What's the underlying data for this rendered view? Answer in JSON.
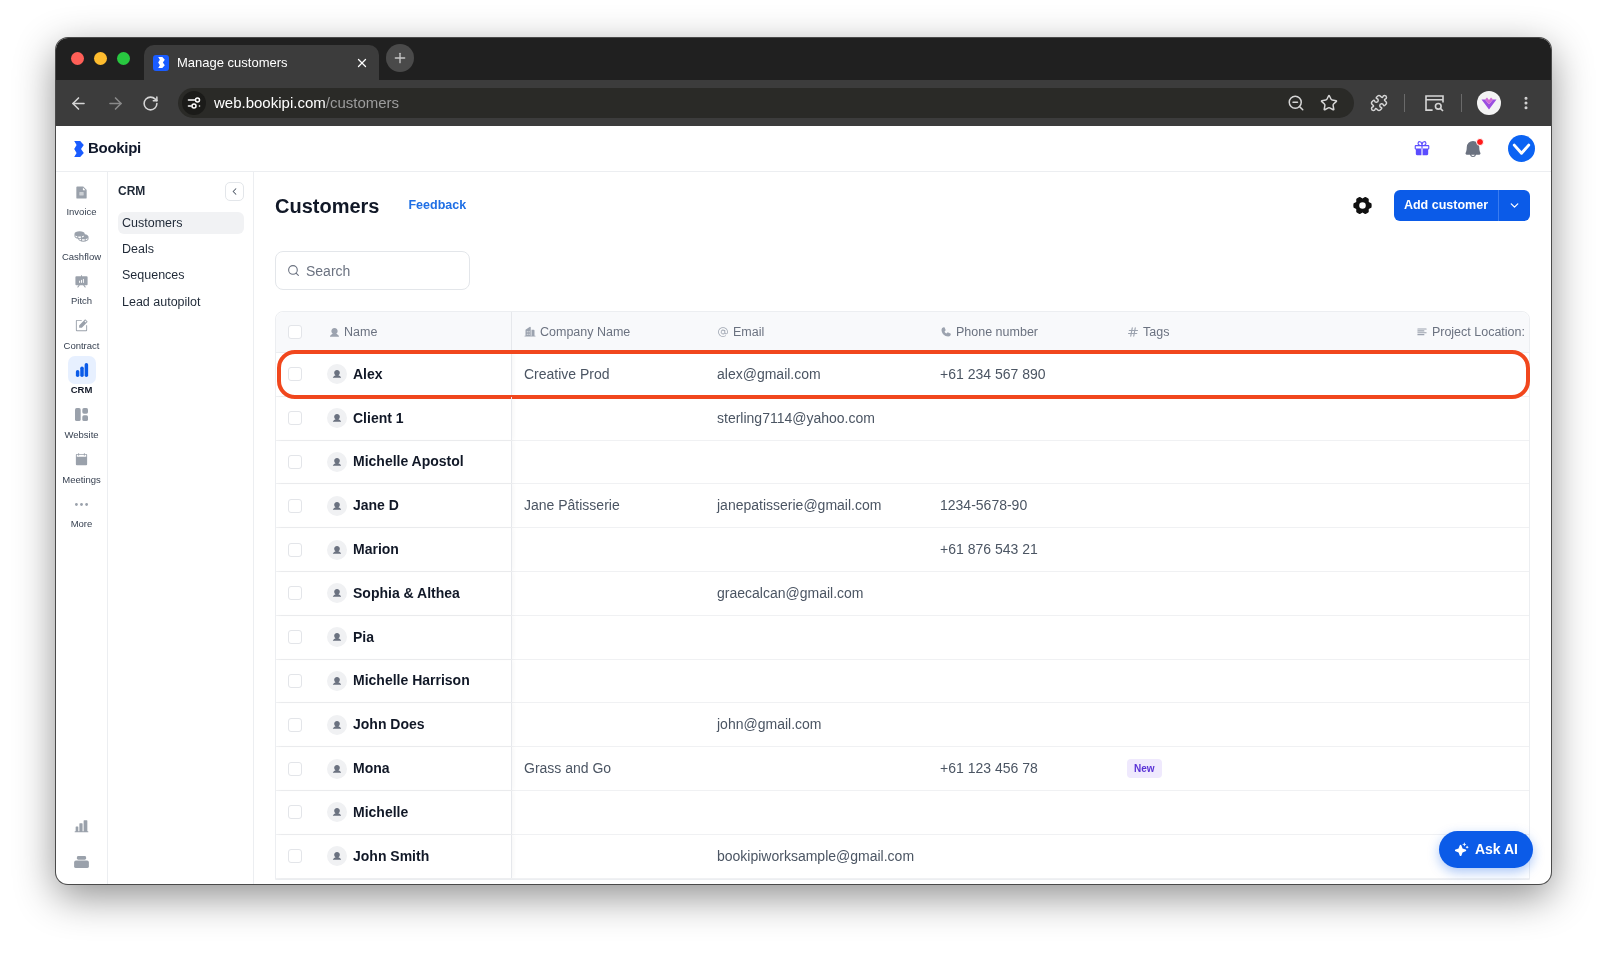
{
  "browser": {
    "tabs": [
      {
        "title": "Manage customers",
        "selected": true
      }
    ],
    "url": {
      "host": "web.bookipi.com",
      "path": "/customers"
    }
  },
  "header": {
    "logo": "Bookipi",
    "has_notifications": true
  },
  "rail": {
    "items": [
      {
        "label": "Invoice",
        "selected": false
      },
      {
        "label": "Cashflow",
        "selected": false
      },
      {
        "label": "Pitch",
        "selected": false
      },
      {
        "label": "Contract",
        "selected": false
      },
      {
        "label": "CRM",
        "selected": true
      },
      {
        "label": "Website",
        "selected": false
      },
      {
        "label": "Meetings",
        "selected": false
      },
      {
        "label": "More",
        "selected": false
      }
    ]
  },
  "crm_panel": {
    "title": "CRM",
    "items": [
      {
        "label": "Customers",
        "selected": true
      },
      {
        "label": "Deals",
        "selected": false
      },
      {
        "label": "Sequences",
        "selected": false
      },
      {
        "label": "Lead autopilot",
        "selected": false
      }
    ]
  },
  "page": {
    "title": "Customers",
    "feedback_link": "Feedback",
    "add_button": "Add customer"
  },
  "search": {
    "placeholder": "Search"
  },
  "table": {
    "select_all_checked": false,
    "columns": [
      "Name",
      "Company Name",
      "Email",
      "Phone number",
      "Tags",
      "Project Location:"
    ],
    "rows": [
      {
        "name": "Alex",
        "company": "Creative Prod",
        "email": "alex@gmail.com",
        "phone": "+61 234 567 890",
        "checked": false,
        "highlighted": true
      },
      {
        "name": "Client 1",
        "email": "sterling7114@yahoo.com",
        "checked": false,
        "highlighted": false
      },
      {
        "name": "Michelle Apostol",
        "checked": false,
        "highlighted": false
      },
      {
        "name": "Jane D",
        "company": "Jane Pâtisserie",
        "email": "janepatisserie@gmail.com",
        "phone": "1234-5678-90",
        "checked": false,
        "highlighted": false
      },
      {
        "name": "Marion",
        "phone": "+61 876 543 21",
        "checked": false,
        "highlighted": false
      },
      {
        "name": "Sophia & Althea",
        "email": "graecalcan@gmail.com",
        "checked": false,
        "highlighted": false
      },
      {
        "name": "Pia",
        "checked": false,
        "highlighted": false
      },
      {
        "name": "Michelle Harrison",
        "checked": false,
        "highlighted": false
      },
      {
        "name": "John Does",
        "email": "john@gmail.com",
        "checked": false,
        "highlighted": false
      },
      {
        "name": "Mona",
        "company": "Grass and Go",
        "phone": "+61 123 456 78",
        "tags": [
          "New"
        ],
        "checked": false,
        "highlighted": false
      },
      {
        "name": "Michelle",
        "checked": false,
        "highlighted": false
      },
      {
        "name": "John Smith",
        "email": "bookipiworksample@gmail.com",
        "checked": false,
        "highlighted": false
      }
    ]
  },
  "ask_ai_button": "Ask AI"
}
